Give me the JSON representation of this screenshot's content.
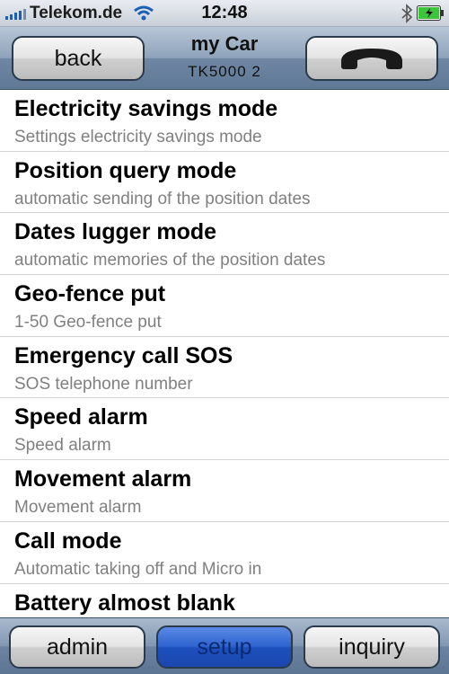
{
  "status": {
    "carrier": "Telekom.de",
    "time": "12:48"
  },
  "nav": {
    "back_label": "back",
    "title": "my Car",
    "subtitle": "TK5000 2"
  },
  "list": [
    {
      "title": "Electricity savings mode",
      "subtitle": "Settings electricity savings mode"
    },
    {
      "title": "Position query mode",
      "subtitle": "automatic sending of the position dates"
    },
    {
      "title": "Dates lugger mode",
      "subtitle": "automatic memories of the position dates"
    },
    {
      "title": "Geo-fence put",
      "subtitle": "1-50 Geo-fence put"
    },
    {
      "title": "Emergency call SOS",
      "subtitle": "SOS telephone number"
    },
    {
      "title": "Speed alarm",
      "subtitle": "Speed alarm"
    },
    {
      "title": "Movement alarm",
      "subtitle": "Movement alarm"
    },
    {
      "title": "Call mode",
      "subtitle": "Automatic taking off and Micro in"
    },
    {
      "title": "Battery almost blank",
      "subtitle": ""
    }
  ],
  "tabs": [
    {
      "label": "admin",
      "active": false
    },
    {
      "label": "setup",
      "active": true
    },
    {
      "label": "inquiry",
      "active": false
    }
  ],
  "colors": {
    "active_tab": "#2f63cf",
    "subtitle_text": "#808080",
    "battery_fill": "#3cc43c"
  }
}
